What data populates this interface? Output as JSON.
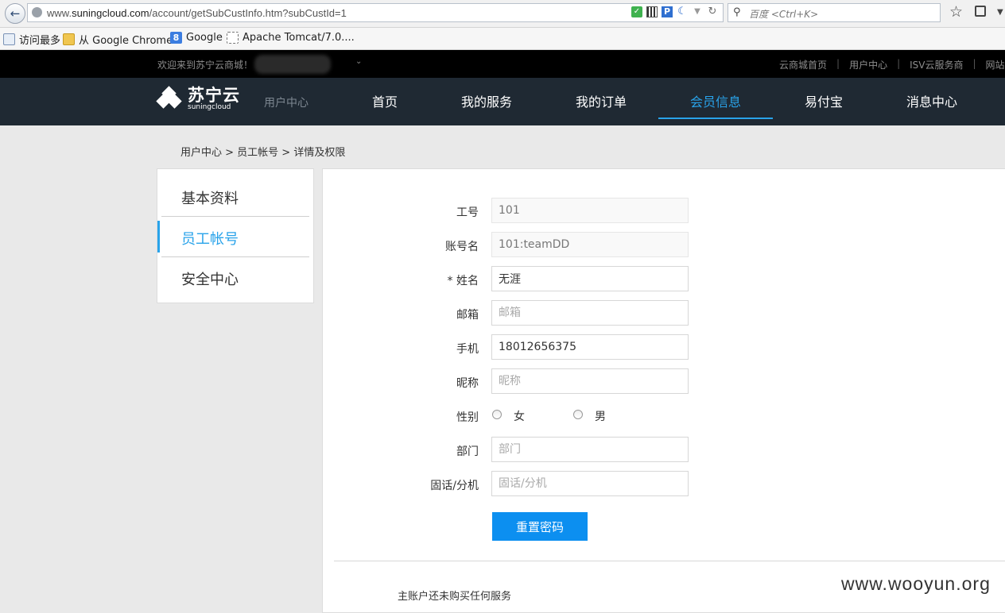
{
  "browser": {
    "url_prefix": "www.",
    "url_domain": "suningcloud.com",
    "url_path": "/account/getSubCustInfo.htm?subCustId=1",
    "search_placeholder": "百度 <Ctrl+K>",
    "icons": [
      "back-arrow-icon",
      "globe-icon",
      "shield-icon",
      "qr-code-icon",
      "p-badge-icon",
      "crescent-icon",
      "dropdown-icon",
      "reload-icon",
      "search-icon",
      "star-icon",
      "library-icon"
    ]
  },
  "bookmarks": [
    {
      "label": "访问最多",
      "icon": "most-visited-icon"
    },
    {
      "label": "从 Google Chrome",
      "icon": "folder-icon"
    },
    {
      "label": "Google",
      "icon": "google-icon"
    },
    {
      "label": "Apache Tomcat/7.0....",
      "icon": "blank-page-icon"
    }
  ],
  "topbar": {
    "welcome": "欢迎来到苏宁云商城！",
    "links": [
      "云商城首页",
      "用户中心",
      "ISV云服务商",
      "网站导"
    ]
  },
  "nav": {
    "logo_cn": "苏宁云",
    "logo_en": "suningcloud",
    "sub_title": "用户中心",
    "items": [
      "首页",
      "我的服务",
      "我的订单",
      "会员信息",
      "易付宝",
      "消息中心"
    ],
    "active_index": 3,
    "accent_color": "#29a3ea"
  },
  "breadcrumb": "用户中心 > 员工帐号 > 详情及权限",
  "sidebar": {
    "items": [
      "基本资料",
      "员工帐号",
      "安全中心"
    ],
    "active_index": 1
  },
  "form": {
    "employee_no": {
      "label": "工号",
      "value": "101"
    },
    "account_name": {
      "label": "账号名",
      "value": "101:teamDD"
    },
    "name": {
      "label": "* 姓名",
      "value": "无涯"
    },
    "email": {
      "label": "邮箱",
      "placeholder": "邮箱"
    },
    "phone": {
      "label": "手机",
      "value": "18012656375"
    },
    "nickname": {
      "label": "昵称",
      "placeholder": "昵称"
    },
    "gender": {
      "label": "性别",
      "options": [
        "女",
        "男"
      ]
    },
    "department": {
      "label": "部门",
      "placeholder": "部门"
    },
    "landline": {
      "label": "固话/分机",
      "placeholder": "固话/分机"
    },
    "reset_button": "重置密码"
  },
  "no_service_text": "主账户还未购买任何服务",
  "watermark": "www.wooyun.org"
}
